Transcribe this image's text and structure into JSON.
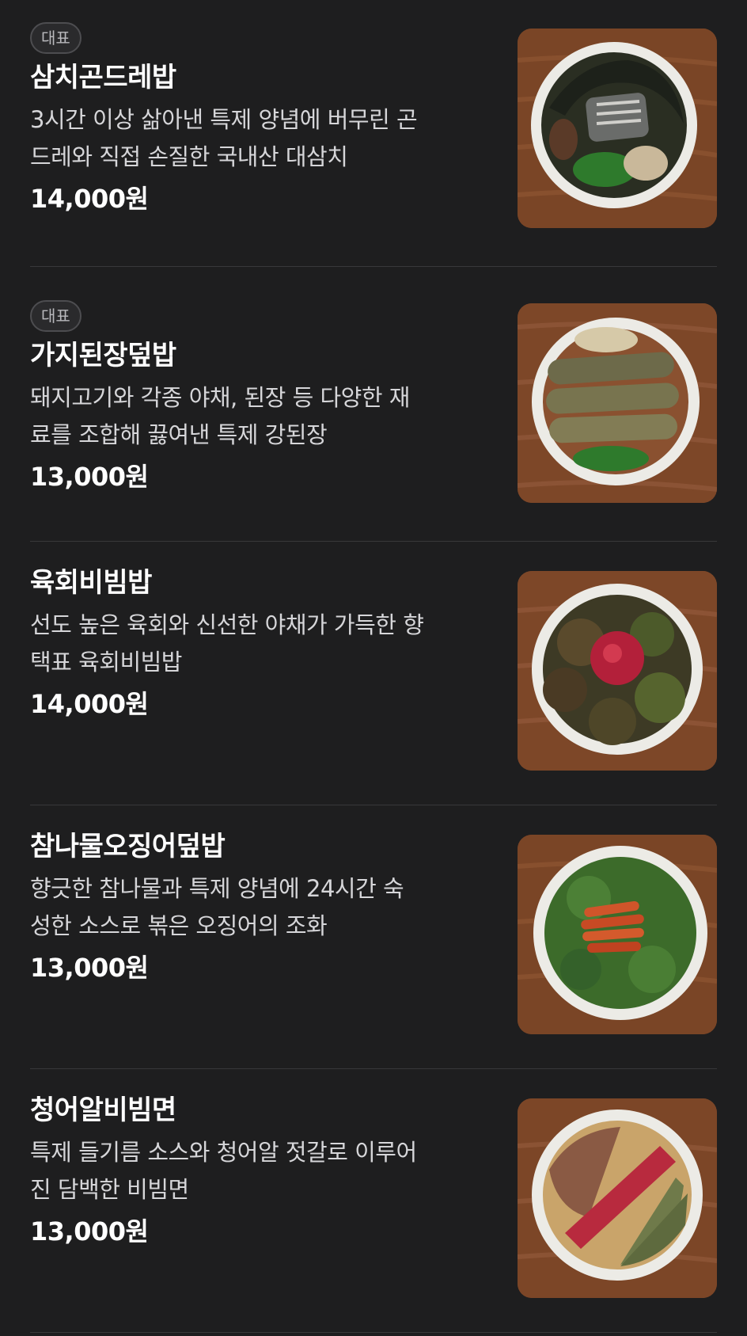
{
  "menu": [
    {
      "badge": "대표",
      "name": "삼치곤드레밥",
      "desc_lines": [
        "3시간 이상 삶아낸 특제 양념에 버무린 곤",
        "드레와 직접 손질한 국내산 대삼치"
      ],
      "price": "14,000원",
      "photo_icon": "samchi-gondre-bowl-photo"
    },
    {
      "badge": "대표",
      "name": "가지된장덮밥",
      "desc_lines": [
        "돼지고기와 각종 야채, 된장 등 다양한 재",
        "료를 조합해 끓여낸 특제 강된장"
      ],
      "price": "13,000원",
      "photo_icon": "eggplant-doenjang-bowl-photo"
    },
    {
      "badge": "",
      "name": "육회비빔밥",
      "desc_lines": [
        "선도 높은 육회와 신선한 야채가 가득한 향",
        "택표 육회비빔밥"
      ],
      "price": "14,000원",
      "photo_icon": "yukhoe-bibimbap-bowl-photo"
    },
    {
      "badge": "",
      "name": "참나물오징어덮밥",
      "desc_lines": [
        "향긋한 참나물과 특제 양념에 24시간 숙",
        "성한 소스로 볶은 오징어의 조화"
      ],
      "price": "13,000원",
      "photo_icon": "chamnamul-squid-bowl-photo"
    },
    {
      "badge": "",
      "name": "청어알비빔면",
      "desc_lines": [
        "특제 들기름 소스와 청어알 젓갈로 이루어",
        "진 담백한 비빔면"
      ],
      "price": "13,000원",
      "photo_icon": "herring-roe-bibimmyeon-bowl-photo"
    }
  ],
  "colors": {
    "background": "#1e1e1f",
    "divider": "#38383a",
    "badge_border": "#4d4d50",
    "wood": "#7a4526",
    "bowl": "#ecebe6"
  }
}
